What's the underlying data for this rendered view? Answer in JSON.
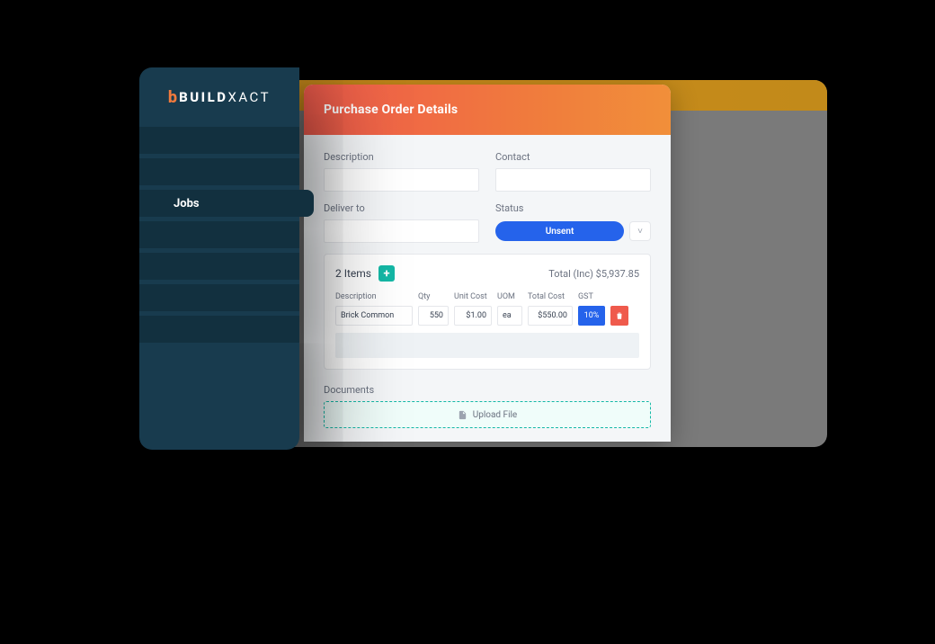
{
  "brand": {
    "mark": "b",
    "name_bold": "BUILD",
    "name_light": "XACT"
  },
  "sidebar": {
    "active_label": "Jobs"
  },
  "panel": {
    "title": "Purchase Order Details",
    "fields": {
      "description_label": "Description",
      "contact_label": "Contact",
      "deliver_to_label": "Deliver to",
      "status_label": "Status",
      "status_value": "Unsent"
    },
    "items": {
      "count_label": "2 Items",
      "total_label": "Total (Inc) $5,937.85",
      "columns": {
        "description": "Description",
        "qty": "Qty",
        "unit_cost": "Unit Cost",
        "uom": "UOM",
        "total_cost": "Total Cost",
        "gst": "GST"
      },
      "rows": [
        {
          "description": "Brick Common",
          "qty": "550",
          "unit_cost": "$1.00",
          "uom": "ea",
          "total_cost": "$550.00",
          "gst": "10%"
        }
      ]
    },
    "documents": {
      "label": "Documents",
      "upload_label": "Upload File"
    }
  }
}
